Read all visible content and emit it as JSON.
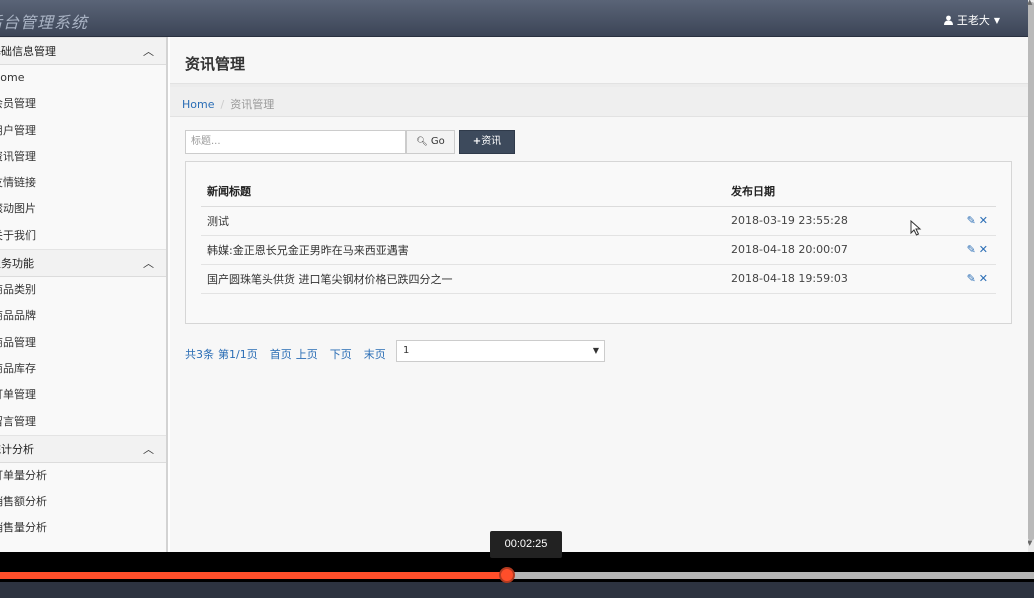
{
  "app": {
    "title": "后台管理系统"
  },
  "user": {
    "name": "王老大",
    "icon": "user-icon"
  },
  "sidebar": {
    "groups": [
      {
        "title": "基础信息管理",
        "items": [
          "Home",
          "会员管理",
          "用户管理",
          "资讯管理",
          "友情链接",
          "滚动图片",
          "关于我们"
        ]
      },
      {
        "title": "业务功能",
        "items": [
          "商品类别",
          "商品品牌",
          "商品管理",
          "商品库存",
          "订单管理",
          "留言管理"
        ]
      },
      {
        "title": "统计分析",
        "items": [
          "订单量分析",
          "销售额分析",
          "销售量分析"
        ]
      }
    ]
  },
  "main": {
    "title": "资讯管理",
    "breadcrumb": {
      "home": "Home",
      "current": "资讯管理"
    },
    "search": {
      "placeholder": "标题...",
      "go_label": "Go"
    },
    "add_label": "资讯",
    "table": {
      "headers": [
        "新闻标题",
        "发布日期"
      ],
      "rows": [
        {
          "title": "测试",
          "date": "2018-03-19 23:55:28"
        },
        {
          "title": "韩媒:金正恩长兄金正男昨在马来西亚遇害",
          "date": "2018-04-18 20:00:07"
        },
        {
          "title": "国产圆珠笔头供货 进口笔尖钢材价格已跌四分之一",
          "date": "2018-04-18 19:59:03"
        }
      ]
    },
    "pager": {
      "total": "共3条",
      "page_info": "第1/1页",
      "first": "首页",
      "prev": "上页",
      "next": "下页",
      "last": "末页",
      "selected": "1"
    }
  },
  "player": {
    "time": "00:02:25",
    "progress": 0.49,
    "accent": "#ff4e2a"
  }
}
